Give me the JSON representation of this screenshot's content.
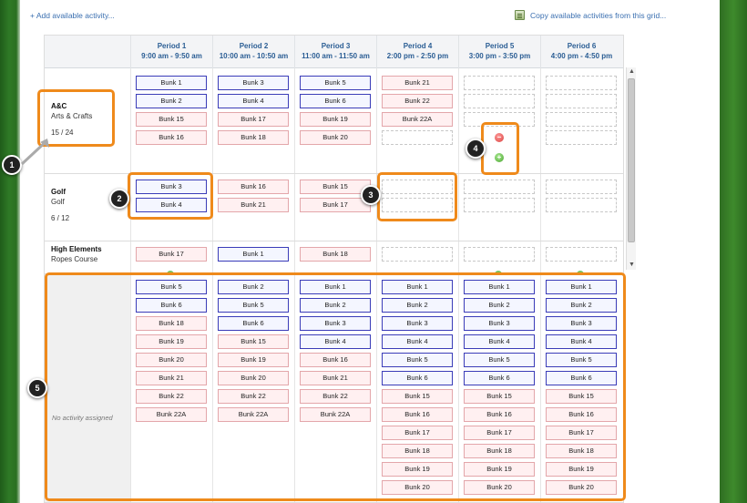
{
  "links": {
    "add": "+ Add available activity...",
    "copy": "Copy available activities from this grid..."
  },
  "periods": [
    {
      "name": "Period 1",
      "time": "9:00 am - 9:50 am"
    },
    {
      "name": "Period 2",
      "time": "10:00 am - 10:50 am"
    },
    {
      "name": "Period 3",
      "time": "11:00 am - 11:50 am"
    },
    {
      "name": "Period 4",
      "time": "2:00 pm - 2:50 pm"
    },
    {
      "name": "Period 5",
      "time": "3:00 pm - 3:50 pm"
    },
    {
      "name": "Period 6",
      "time": "4:00 pm - 4:50 pm"
    }
  ],
  "activities": [
    {
      "code": "A&C",
      "name": "Arts & Crafts",
      "count": "15 / 24",
      "periods": [
        [
          {
            "label": "Bunk 1",
            "style": "blue"
          },
          {
            "label": "Bunk 2",
            "style": "blue"
          },
          {
            "label": "Bunk 15",
            "style": "pink"
          },
          {
            "label": "Bunk 16",
            "style": "pink"
          }
        ],
        [
          {
            "label": "Bunk 3",
            "style": "blue"
          },
          {
            "label": "Bunk 4",
            "style": "blue"
          },
          {
            "label": "Bunk 17",
            "style": "pink"
          },
          {
            "label": "Bunk 18",
            "style": "pink"
          }
        ],
        [
          {
            "label": "Bunk 5",
            "style": "blue"
          },
          {
            "label": "Bunk 6",
            "style": "blue"
          },
          {
            "label": "Bunk 19",
            "style": "pink"
          },
          {
            "label": "Bunk 20",
            "style": "pink"
          }
        ],
        [
          {
            "label": "Bunk 21",
            "style": "pink"
          },
          {
            "label": "Bunk 22",
            "style": "pink"
          },
          {
            "label": "Bunk 22A",
            "style": "pink"
          },
          {
            "label": "",
            "style": "empty"
          }
        ],
        [
          {
            "label": "",
            "style": "empty"
          },
          {
            "label": "",
            "style": "empty"
          },
          {
            "label": "",
            "style": "empty"
          }
        ],
        [
          {
            "label": "",
            "style": "empty"
          },
          {
            "label": "",
            "style": "empty"
          },
          {
            "label": "",
            "style": "empty"
          },
          {
            "label": "",
            "style": "empty"
          }
        ]
      ]
    },
    {
      "code": "Golf",
      "name": "Golf",
      "count": "6 / 12",
      "periods": [
        [
          {
            "label": "Bunk 3",
            "style": "blue"
          },
          {
            "label": "Bunk 4",
            "style": "blue"
          }
        ],
        [
          {
            "label": "Bunk 16",
            "style": "pink"
          },
          {
            "label": "Bunk 21",
            "style": "pink"
          }
        ],
        [
          {
            "label": "Bunk 15",
            "style": "pink"
          },
          {
            "label": "Bunk 17",
            "style": "pink"
          }
        ],
        [
          {
            "label": "",
            "style": "empty"
          },
          {
            "label": "",
            "style": "empty"
          }
        ],
        [
          {
            "label": "",
            "style": "empty"
          },
          {
            "label": "",
            "style": "empty"
          }
        ],
        [
          {
            "label": "",
            "style": "empty"
          },
          {
            "label": "",
            "style": "empty"
          }
        ]
      ]
    },
    {
      "code": "High Elements",
      "name": "Ropes Course",
      "count": "",
      "periods": [
        [
          {
            "label": "Bunk 17",
            "style": "pink"
          }
        ],
        [
          {
            "label": "Bunk 1",
            "style": "blue"
          }
        ],
        [
          {
            "label": "Bunk 18",
            "style": "pink"
          }
        ],
        [
          {
            "label": "",
            "style": "empty"
          }
        ],
        [
          {
            "label": "",
            "style": "empty"
          }
        ],
        [
          {
            "label": "",
            "style": "empty"
          }
        ]
      ]
    }
  ],
  "unassigned": {
    "label": "No activity assigned",
    "periods": [
      [
        {
          "label": "Bunk 5",
          "style": "blue"
        },
        {
          "label": "Bunk 6",
          "style": "blue"
        },
        {
          "label": "Bunk 18",
          "style": "pink"
        },
        {
          "label": "Bunk 19",
          "style": "pink"
        },
        {
          "label": "Bunk 20",
          "style": "pink"
        },
        {
          "label": "Bunk 21",
          "style": "pink"
        },
        {
          "label": "Bunk 22",
          "style": "pink"
        },
        {
          "label": "Bunk 22A",
          "style": "pink"
        }
      ],
      [
        {
          "label": "Bunk 2",
          "style": "blue"
        },
        {
          "label": "Bunk 5",
          "style": "blue"
        },
        {
          "label": "Bunk 6",
          "style": "blue"
        },
        {
          "label": "Bunk 15",
          "style": "pink"
        },
        {
          "label": "Bunk 19",
          "style": "pink"
        },
        {
          "label": "Bunk 20",
          "style": "pink"
        },
        {
          "label": "Bunk 22",
          "style": "pink"
        },
        {
          "label": "Bunk 22A",
          "style": "pink"
        }
      ],
      [
        {
          "label": "Bunk 1",
          "style": "blue"
        },
        {
          "label": "Bunk 2",
          "style": "blue"
        },
        {
          "label": "Bunk 3",
          "style": "blue"
        },
        {
          "label": "Bunk 4",
          "style": "blue"
        },
        {
          "label": "Bunk 16",
          "style": "pink"
        },
        {
          "label": "Bunk 21",
          "style": "pink"
        },
        {
          "label": "Bunk 22",
          "style": "pink"
        },
        {
          "label": "Bunk 22A",
          "style": "pink"
        }
      ],
      [
        {
          "label": "Bunk 1",
          "style": "blue"
        },
        {
          "label": "Bunk 2",
          "style": "blue"
        },
        {
          "label": "Bunk 3",
          "style": "blue"
        },
        {
          "label": "Bunk 4",
          "style": "blue"
        },
        {
          "label": "Bunk 5",
          "style": "blue"
        },
        {
          "label": "Bunk 6",
          "style": "blue"
        },
        {
          "label": "Bunk 15",
          "style": "pink"
        },
        {
          "label": "Bunk 16",
          "style": "pink"
        },
        {
          "label": "Bunk 17",
          "style": "pink"
        },
        {
          "label": "Bunk 18",
          "style": "pink"
        },
        {
          "label": "Bunk 19",
          "style": "pink"
        },
        {
          "label": "Bunk 20",
          "style": "pink"
        }
      ],
      [
        {
          "label": "Bunk 1",
          "style": "blue"
        },
        {
          "label": "Bunk 2",
          "style": "blue"
        },
        {
          "label": "Bunk 3",
          "style": "blue"
        },
        {
          "label": "Bunk 4",
          "style": "blue"
        },
        {
          "label": "Bunk 5",
          "style": "blue"
        },
        {
          "label": "Bunk 6",
          "style": "blue"
        },
        {
          "label": "Bunk 15",
          "style": "pink"
        },
        {
          "label": "Bunk 16",
          "style": "pink"
        },
        {
          "label": "Bunk 17",
          "style": "pink"
        },
        {
          "label": "Bunk 18",
          "style": "pink"
        },
        {
          "label": "Bunk 19",
          "style": "pink"
        },
        {
          "label": "Bunk 20",
          "style": "pink"
        }
      ],
      [
        {
          "label": "Bunk 1",
          "style": "blue"
        },
        {
          "label": "Bunk 2",
          "style": "blue"
        },
        {
          "label": "Bunk 3",
          "style": "blue"
        },
        {
          "label": "Bunk 4",
          "style": "blue"
        },
        {
          "label": "Bunk 5",
          "style": "blue"
        },
        {
          "label": "Bunk 6",
          "style": "blue"
        },
        {
          "label": "Bunk 15",
          "style": "pink"
        },
        {
          "label": "Bunk 16",
          "style": "pink"
        },
        {
          "label": "Bunk 17",
          "style": "pink"
        },
        {
          "label": "Bunk 18",
          "style": "pink"
        },
        {
          "label": "Bunk 19",
          "style": "pink"
        },
        {
          "label": "Bunk 20",
          "style": "pink"
        }
      ]
    ]
  },
  "callouts": [
    "1",
    "2",
    "3",
    "4",
    "5"
  ],
  "icons": {
    "remove": "minus-circle-icon",
    "add": "plus-circle-icon",
    "copy": "copy-grid-icon"
  },
  "colors": {
    "highlight": "#ef8a1b",
    "link": "#3a6fb0",
    "assigned_border": "#3a3cb8",
    "conflict_border": "#e3a6aa"
  }
}
